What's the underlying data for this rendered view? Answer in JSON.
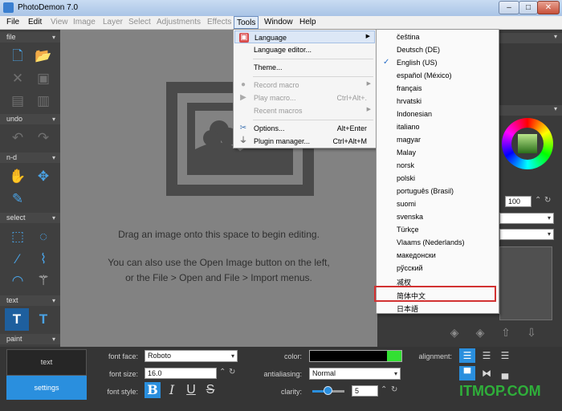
{
  "window": {
    "title": "PhotoDemon 7.0"
  },
  "menubar": {
    "items": [
      {
        "label": "File",
        "state": "normal"
      },
      {
        "label": "Edit",
        "state": "normal"
      },
      {
        "label": "View",
        "state": "disabled"
      },
      {
        "label": "Image",
        "state": "disabled"
      },
      {
        "label": "Layer",
        "state": "disabled"
      },
      {
        "label": "Select",
        "state": "disabled"
      },
      {
        "label": "Adjustments",
        "state": "disabled"
      },
      {
        "label": "Effects",
        "state": "disabled"
      },
      {
        "label": "Tools",
        "state": "active"
      },
      {
        "label": "Window",
        "state": "normal"
      },
      {
        "label": "Help",
        "state": "normal"
      }
    ]
  },
  "left_toolbar": {
    "sections": [
      "file",
      "undo",
      "n-d",
      "select",
      "text",
      "paint"
    ]
  },
  "canvas": {
    "hint_line1": "Drag an image onto this space to begin editing.",
    "hint_line2": "You can also use the Open Image button on the left,",
    "hint_line3": "or the File > Open and File > Import menus."
  },
  "tools_menu": {
    "items": [
      {
        "label": "Language",
        "shortcut": "",
        "submenu": true,
        "icon": "language-icon",
        "state": "highlighted"
      },
      {
        "label": "Language editor...",
        "shortcut": "",
        "submenu": false,
        "icon": "",
        "state": "normal"
      },
      {
        "label": "Theme...",
        "shortcut": "",
        "submenu": false,
        "icon": "",
        "state": "normal"
      },
      {
        "label": "Record macro",
        "shortcut": "",
        "submenu": true,
        "icon": "record-icon",
        "state": "disabled"
      },
      {
        "label": "Play macro...",
        "shortcut": "Ctrl+Alt+.",
        "submenu": false,
        "icon": "play-icon",
        "state": "disabled"
      },
      {
        "label": "Recent macros",
        "shortcut": "",
        "submenu": true,
        "icon": "",
        "state": "disabled"
      },
      {
        "label": "Options...",
        "shortcut": "Alt+Enter",
        "submenu": false,
        "icon": "wrench-icon",
        "state": "normal"
      },
      {
        "label": "Plugin manager...",
        "shortcut": "Ctrl+Alt+M",
        "submenu": false,
        "icon": "plug-icon",
        "state": "normal"
      }
    ]
  },
  "language_menu": {
    "items": [
      {
        "label": "čeština",
        "checked": false,
        "boxed": false
      },
      {
        "label": "Deutsch (DE)",
        "checked": false,
        "boxed": false
      },
      {
        "label": "English (US)",
        "checked": true,
        "boxed": false
      },
      {
        "label": "español (México)",
        "checked": false,
        "boxed": false
      },
      {
        "label": "français",
        "checked": false,
        "boxed": false
      },
      {
        "label": "hrvatski",
        "checked": false,
        "boxed": false
      },
      {
        "label": "Indonesian",
        "checked": false,
        "boxed": false
      },
      {
        "label": "italiano",
        "checked": false,
        "boxed": false
      },
      {
        "label": "magyar",
        "checked": false,
        "boxed": false
      },
      {
        "label": "Malay",
        "checked": false,
        "boxed": false
      },
      {
        "label": "norsk",
        "checked": false,
        "boxed": false
      },
      {
        "label": "polski",
        "checked": false,
        "boxed": false
      },
      {
        "label": "português (Brasil)",
        "checked": false,
        "boxed": false
      },
      {
        "label": "suomi",
        "checked": false,
        "boxed": false
      },
      {
        "label": "svenska",
        "checked": false,
        "boxed": false
      },
      {
        "label": "Türkçe",
        "checked": false,
        "boxed": false
      },
      {
        "label": "Vlaams (Nederlands)",
        "checked": false,
        "boxed": false
      },
      {
        "label": "македонски",
        "checked": false,
        "boxed": false
      },
      {
        "label": "рўсский",
        "checked": false,
        "boxed": false
      },
      {
        "label": "㓕杈",
        "checked": false,
        "boxed": false
      },
      {
        "label": "简体中文",
        "checked": false,
        "boxed": true
      },
      {
        "label": "日本語",
        "checked": false,
        "boxed": false
      }
    ]
  },
  "right_panel": {
    "opacity_value": "100"
  },
  "options_panel": {
    "tabs": {
      "text": "text",
      "settings": "settings"
    },
    "font_face_label": "font face:",
    "font_face_value": "Roboto",
    "font_size_label": "font size:",
    "font_size_value": "16.0",
    "font_style_label": "font style:",
    "style_buttons": [
      "B",
      "I",
      "U",
      "S"
    ],
    "color_label": "color:",
    "antialiasing_label": "antialiasing:",
    "antialiasing_value": "Normal",
    "clarity_label": "clarity:",
    "clarity_value": "5",
    "clarity_level": 0.5,
    "alignment_label": "alignment:"
  },
  "colors": {
    "accent": "#2a8fde",
    "canvas": "#828282",
    "highlight_box": "#d23232",
    "text_color_swatch": "#33e033"
  },
  "watermark": "ITMOP.COM"
}
